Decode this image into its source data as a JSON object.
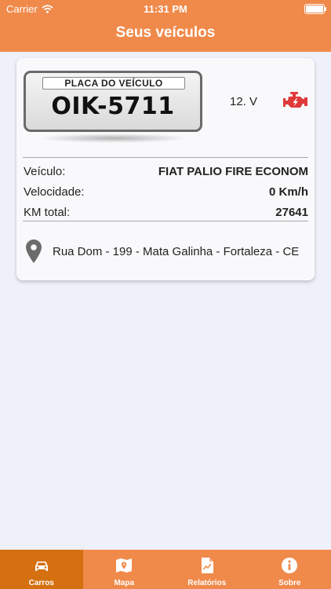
{
  "status_bar": {
    "carrier": "Carrier",
    "time": "11:31 PM"
  },
  "header": {
    "title": "Seus veículos"
  },
  "vehicle": {
    "plate_header": "PLACA DO VEÍCULO",
    "plate_number": "OIK-5711",
    "voltage": "12. V",
    "engine_status_color": "#e03a3a",
    "details": [
      {
        "label": "Veículo:",
        "value": "FIAT PALIO FIRE ECONOM"
      },
      {
        "label": "Velocidade:",
        "value": "0 Km/h"
      },
      {
        "label": "KM total:",
        "value": "27641"
      }
    ],
    "address": "Rua Dom - 199 - Mata Galinha - Fortaleza - CE"
  },
  "tabs": [
    {
      "label": "Carros",
      "icon": "car-icon",
      "active": true
    },
    {
      "label": "Mapa",
      "icon": "map-icon",
      "active": false
    },
    {
      "label": "Relatórios",
      "icon": "report-icon",
      "active": false
    },
    {
      "label": "Sobre",
      "icon": "info-icon",
      "active": false
    }
  ],
  "colors": {
    "brand": "#f08a4b",
    "active_tab": "#d57010",
    "background": "#eef1f9"
  }
}
